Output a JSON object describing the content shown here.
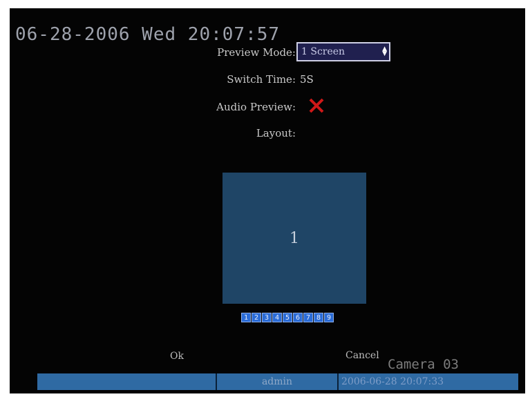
{
  "osd": {
    "datetime": "06-28-2006 Wed 20:07:57",
    "camera": "Camera 03"
  },
  "form": {
    "preview_mode_label": "Preview Mode:",
    "preview_mode_value": "1 Screen",
    "switch_time_label": "Switch Time:",
    "switch_time_value": "5S",
    "audio_preview_label": "Audio Preview:",
    "audio_preview_enabled": false,
    "layout_label": "Layout:"
  },
  "layout": {
    "cell": "1",
    "pages": [
      "1",
      "2",
      "3",
      "4",
      "5",
      "6",
      "7",
      "8",
      "9"
    ]
  },
  "buttons": {
    "ok": "Ok",
    "cancel": "Cancel"
  },
  "status": {
    "blank": "",
    "user": "admin",
    "datetime": "2006-06-28 20:07:33"
  },
  "colors": {
    "osd_background": "#040404",
    "layout_cell": "#1f4566",
    "status_bar": "#2f6aa3",
    "disabled_x": "#d01818"
  }
}
